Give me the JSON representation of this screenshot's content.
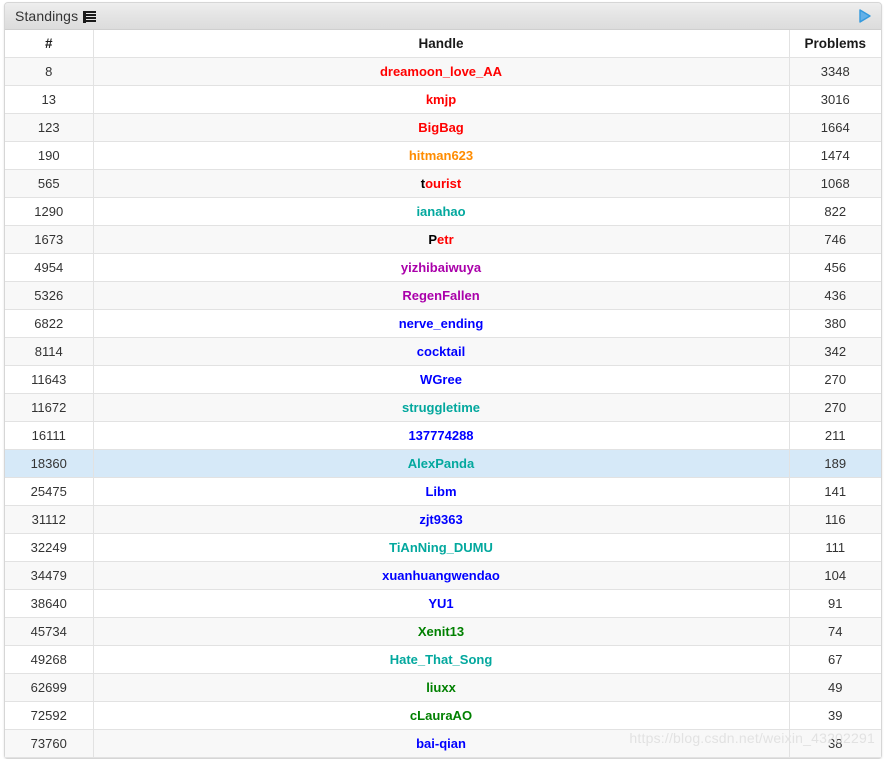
{
  "widget": {
    "title": "Standings",
    "list_icon": "list-icon",
    "expand_icon": "play-arrow-icon",
    "accent_arrow_color": "#3399dd"
  },
  "table": {
    "columns": [
      {
        "key": "rank",
        "label": "#"
      },
      {
        "key": "handle",
        "label": "Handle"
      },
      {
        "key": "problems",
        "label": "Problems"
      }
    ],
    "rows": [
      {
        "rank": "8",
        "handle": "dreamoon_love_AA",
        "first_letter": "",
        "color": "#ff0000",
        "color_class": "rc-red",
        "problems": "3348",
        "highlight": false
      },
      {
        "rank": "13",
        "handle": "kmjp",
        "first_letter": "",
        "color": "#ff0000",
        "color_class": "rc-red",
        "problems": "3016",
        "highlight": false
      },
      {
        "rank": "123",
        "handle": "BigBag",
        "first_letter": "",
        "color": "#ff0000",
        "color_class": "rc-red",
        "problems": "1664",
        "highlight": false
      },
      {
        "rank": "190",
        "handle": "hitman623",
        "first_letter": "",
        "color": "#ff8c00",
        "color_class": "rc-orange",
        "problems": "1474",
        "highlight": false
      },
      {
        "rank": "565",
        "handle": "ourist",
        "first_letter": "t",
        "color": "#ff0000",
        "color_class": "rc-red",
        "problems": "1068",
        "highlight": false
      },
      {
        "rank": "1290",
        "handle": "ianahao",
        "first_letter": "",
        "color": "#03a89e",
        "color_class": "rc-cyan",
        "problems": "822",
        "highlight": false
      },
      {
        "rank": "1673",
        "handle": "etr",
        "first_letter": "P",
        "color": "#ff0000",
        "color_class": "rc-red",
        "problems": "746",
        "highlight": false
      },
      {
        "rank": "4954",
        "handle": "yizhibaiwuya",
        "first_letter": "",
        "color": "#aa00aa",
        "color_class": "rc-violet",
        "problems": "456",
        "highlight": false
      },
      {
        "rank": "5326",
        "handle": "RegenFallen",
        "first_letter": "",
        "color": "#aa00aa",
        "color_class": "rc-violet",
        "problems": "436",
        "highlight": false
      },
      {
        "rank": "6822",
        "handle": "nerve_ending",
        "first_letter": "",
        "color": "#0000ff",
        "color_class": "rc-blue",
        "problems": "380",
        "highlight": false
      },
      {
        "rank": "8114",
        "handle": "cocktail",
        "first_letter": "",
        "color": "#0000ff",
        "color_class": "rc-blue",
        "problems": "342",
        "highlight": false
      },
      {
        "rank": "11643",
        "handle": "WGree",
        "first_letter": "",
        "color": "#0000ff",
        "color_class": "rc-blue",
        "problems": "270",
        "highlight": false
      },
      {
        "rank": "11672",
        "handle": "struggletime",
        "first_letter": "",
        "color": "#03a89e",
        "color_class": "rc-cyan",
        "problems": "270",
        "highlight": false
      },
      {
        "rank": "16111",
        "handle": "137774288",
        "first_letter": "",
        "color": "#0000ff",
        "color_class": "rc-blue",
        "problems": "211",
        "highlight": false
      },
      {
        "rank": "18360",
        "handle": "AlexPanda",
        "first_letter": "",
        "color": "#03a89e",
        "color_class": "rc-cyan",
        "problems": "189",
        "highlight": true
      },
      {
        "rank": "25475",
        "handle": "Libm",
        "first_letter": "",
        "color": "#0000ff",
        "color_class": "rc-blue",
        "problems": "141",
        "highlight": false
      },
      {
        "rank": "31112",
        "handle": "zjt9363",
        "first_letter": "",
        "color": "#0000ff",
        "color_class": "rc-blue",
        "problems": "116",
        "highlight": false
      },
      {
        "rank": "32249",
        "handle": "TiAnNing_DUMU",
        "first_letter": "",
        "color": "#03a89e",
        "color_class": "rc-cyan",
        "problems": "111",
        "highlight": false
      },
      {
        "rank": "34479",
        "handle": "xuanhuangwendao",
        "first_letter": "",
        "color": "#0000ff",
        "color_class": "rc-blue",
        "problems": "104",
        "highlight": false
      },
      {
        "rank": "38640",
        "handle": "YU1",
        "first_letter": "",
        "color": "#0000ff",
        "color_class": "rc-blue",
        "problems": "91",
        "highlight": false
      },
      {
        "rank": "45734",
        "handle": "Xenit13",
        "first_letter": "",
        "color": "#008000",
        "color_class": "rc-green",
        "problems": "74",
        "highlight": false
      },
      {
        "rank": "49268",
        "handle": "Hate_That_Song",
        "first_letter": "",
        "color": "#03a89e",
        "color_class": "rc-cyan",
        "problems": "67",
        "highlight": false
      },
      {
        "rank": "62699",
        "handle": "liuxx",
        "first_letter": "",
        "color": "#008000",
        "color_class": "rc-green",
        "problems": "49",
        "highlight": false
      },
      {
        "rank": "72592",
        "handle": "cLauraAO",
        "first_letter": "",
        "color": "#008000",
        "color_class": "rc-green",
        "problems": "39",
        "highlight": false
      },
      {
        "rank": "73760",
        "handle": "bai-qian",
        "first_letter": "",
        "color": "#0000ff",
        "color_class": "rc-blue",
        "problems": "38",
        "highlight": false
      }
    ]
  },
  "watermark": {
    "text": "https://blog.csdn.net/weixin_43202291"
  }
}
